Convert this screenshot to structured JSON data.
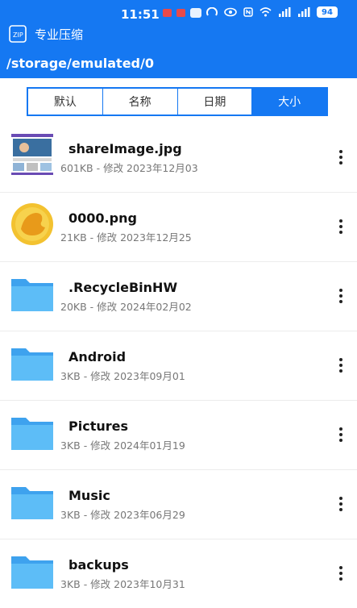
{
  "status_bar": {
    "time": "11:51",
    "battery": "94"
  },
  "header": {
    "app_title": "专业压缩",
    "path": "/storage/emulated/0"
  },
  "sort_tabs": [
    {
      "label": "默认",
      "active": false
    },
    {
      "label": "名称",
      "active": false
    },
    {
      "label": "日期",
      "active": false
    },
    {
      "label": "大小",
      "active": true
    }
  ],
  "files": [
    {
      "name": "shareImage.jpg",
      "meta": "601KB - 修改 2023年12月03",
      "kind": "image-thumbnail"
    },
    {
      "name": "0000.png",
      "meta": "21KB - 修改 2023年12月25",
      "kind": "orange-circle-image"
    },
    {
      "name": ".RecycleBinHW",
      "meta": "20KB - 修改 2024年02月02",
      "kind": "folder"
    },
    {
      "name": "Android",
      "meta": "3KB - 修改 2023年09月01",
      "kind": "folder"
    },
    {
      "name": "Pictures",
      "meta": "3KB - 修改 2024年01月19",
      "kind": "folder"
    },
    {
      "name": "Music",
      "meta": "3KB - 修改 2023年06月29",
      "kind": "folder"
    },
    {
      "name": "backups",
      "meta": "3KB - 修改 2023年10月31",
      "kind": "folder"
    }
  ],
  "colors": {
    "accent": "#1578f2",
    "folder": "#4fb0f2"
  }
}
